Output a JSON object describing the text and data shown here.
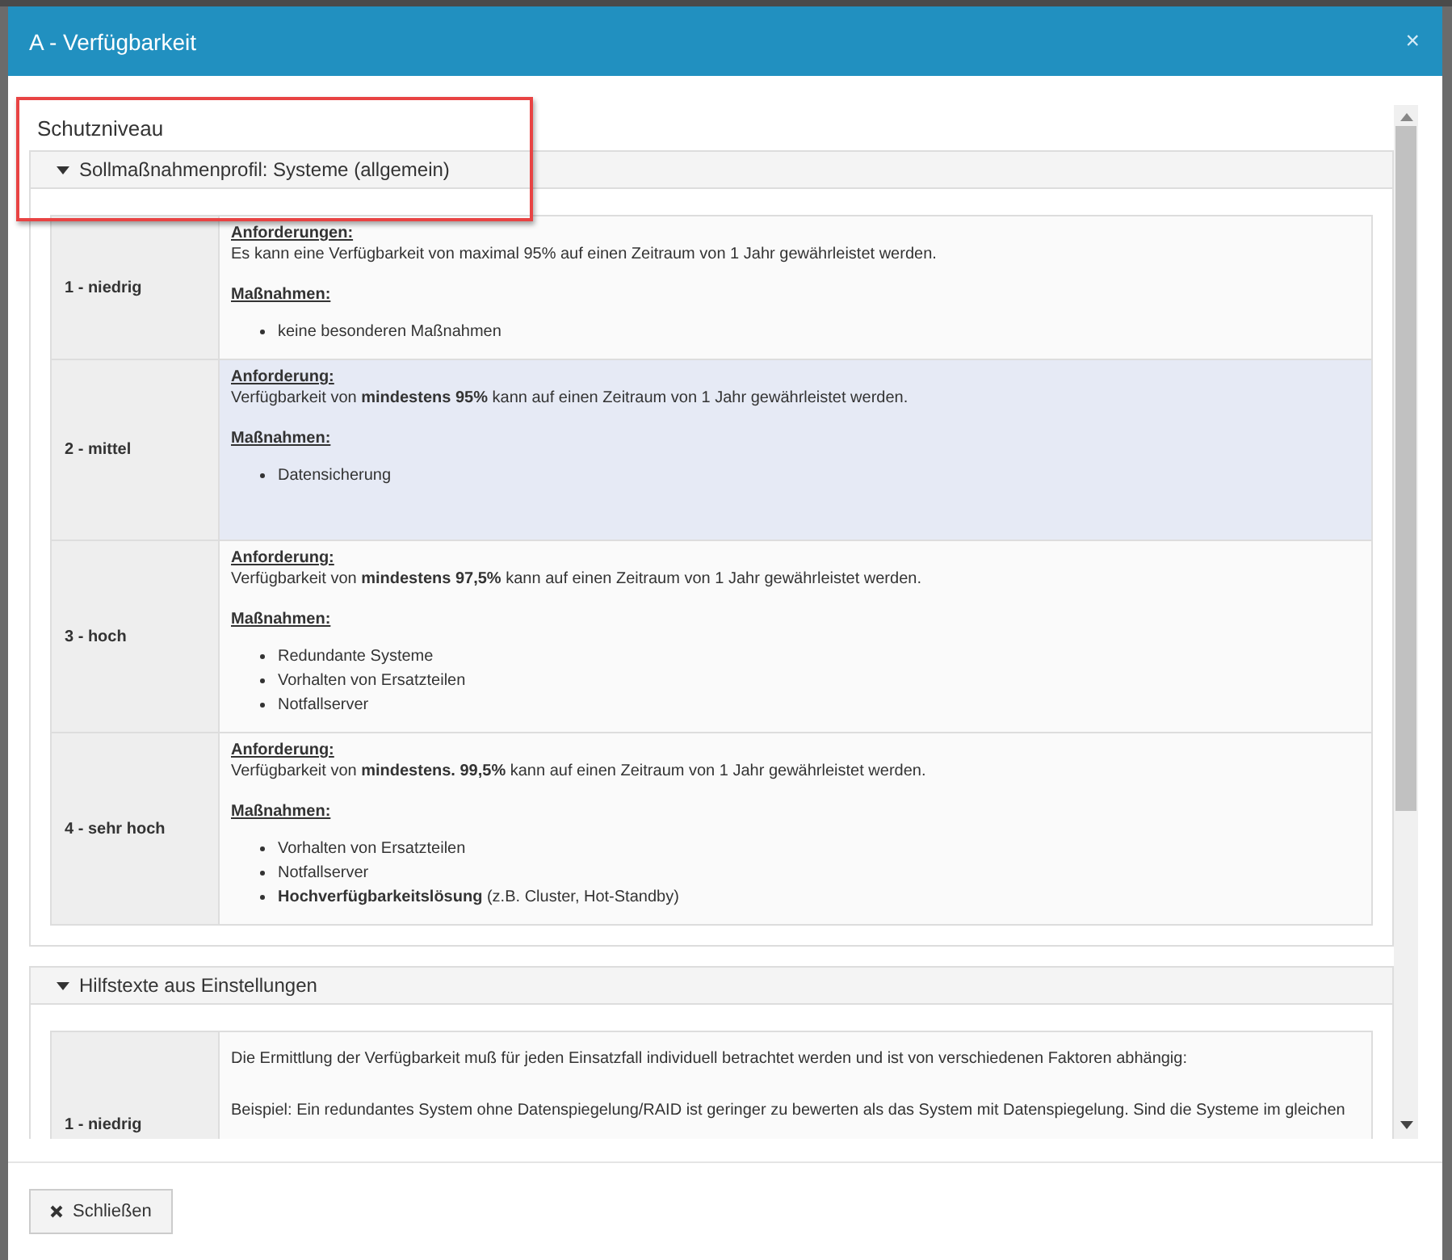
{
  "dialog": {
    "title": "A - Verfügbarkeit",
    "close": "×"
  },
  "heading": "Schutzniveau",
  "sections": [
    {
      "title": "Sollmaßnahmenprofil: Systeme (allgemein)",
      "expanded": true,
      "rows": [
        {
          "level": "1 - niedrig",
          "selected": false,
          "kind": "profile",
          "requirement_label": "Anforderungen:",
          "requirement": "Es kann eine Verfügbarkeit von maximal 95% auf einen Zeitraum von 1 Jahr gewährleistet werden.",
          "measures_label": "Maßnahmen:",
          "measures": [
            "keine besonderen Maßnahmen"
          ]
        },
        {
          "level": "2 - mittel",
          "selected": true,
          "kind": "profile",
          "requirement_label": "Anforderung:",
          "requirement": "Verfügbarkeit von **mindestens 95%** kann auf einen Zeitraum von 1 Jahr gewährleistet werden.",
          "measures_label": "Maßnahmen:",
          "measures": [
            "Datensicherung"
          ]
        },
        {
          "level": "3 - hoch",
          "selected": false,
          "kind": "profile",
          "requirement_label": "Anforderung:",
          "requirement": "Verfügbarkeit von **mindestens 97,5%** kann auf einen Zeitraum von 1 Jahr gewährleistet werden.",
          "measures_label": "Maßnahmen:",
          "measures": [
            "Redundante Systeme",
            "Vorhalten von Ersatzteilen",
            "Notfallserver"
          ]
        },
        {
          "level": "4 - sehr hoch",
          "selected": false,
          "kind": "profile",
          "requirement_label": "Anforderung:",
          "requirement": "Verfügbarkeit von **mindestens. 99,5%** kann auf einen Zeitraum von 1 Jahr gewährleistet werden.",
          "measures_label": "Maßnahmen:",
          "measures": [
            "Vorhalten von Ersatzteilen",
            "Notfallserver",
            " **Hochverfügbarkeitslösung** (z.B. Cluster, Hot-Standby)"
          ]
        }
      ]
    },
    {
      "title": "Hilfstexte aus Einstellungen",
      "expanded": true,
      "rows": [
        {
          "level": "1 - niedrig",
          "selected": false,
          "kind": "help",
          "paragraphs": [
            "Die Ermittlung der Verfügbarkeit muß für jeden Einsatzfall individuell betrachtet werden und ist von verschiedenen Faktoren abhängig:",
            "Beispiel: Ein redundantes System ohne Datenspiegelung/RAID ist geringer zu bewerten als das System mit Datenspiegelung. Sind die Systeme  im gleichen"
          ]
        }
      ]
    }
  ],
  "footer": {
    "close_button": "Schließen"
  }
}
